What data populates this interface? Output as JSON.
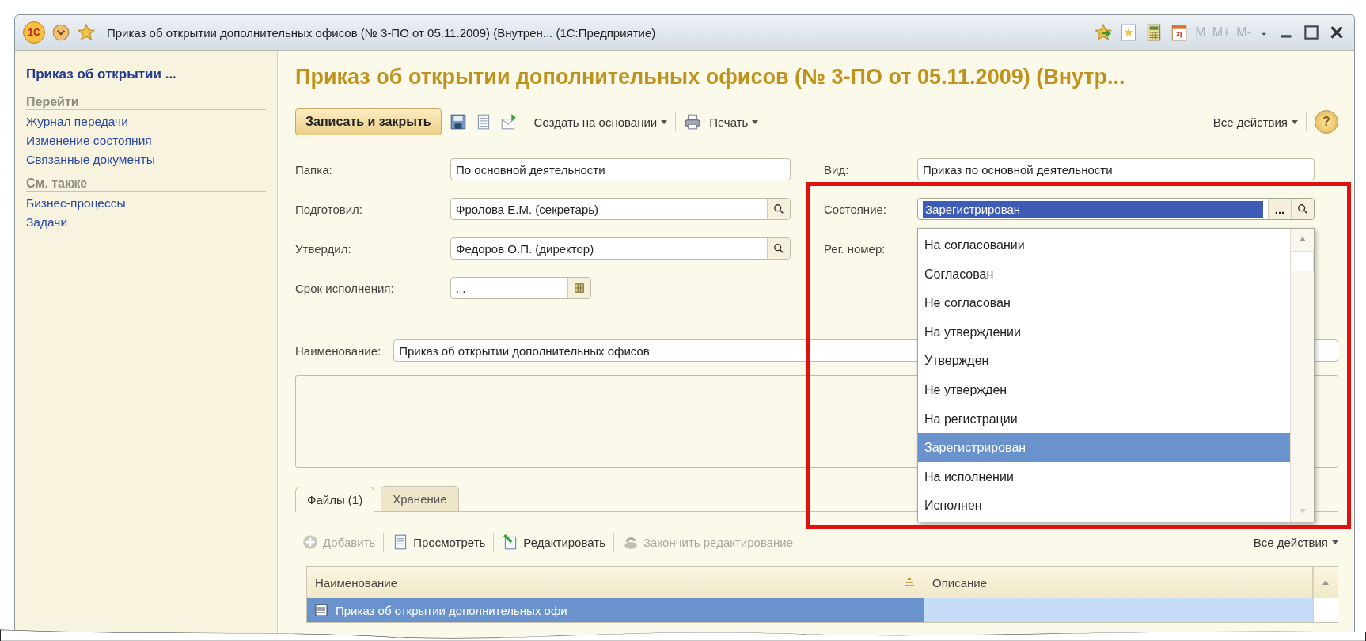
{
  "title_bar": {
    "logo": "1С",
    "title": "Приказ об открытии дополнительных офисов (№ 3-ПО от 05.11.2009) (Внутрен...  (1С:Предприятие)",
    "memory_buttons": [
      "M",
      "M+",
      "M-"
    ]
  },
  "sidebar": {
    "title": "Приказ об открытии ...",
    "sections": [
      {
        "heading": "Перейти",
        "items": [
          "Журнал передачи",
          "Изменение состояния",
          "Связанные документы"
        ]
      },
      {
        "heading": "См. также",
        "items": [
          "Бизнес-процессы",
          "Задачи"
        ]
      }
    ]
  },
  "form": {
    "title": "Приказ об открытии дополнительных офисов (№ 3-ПО от 05.11.2009) (Внутр...",
    "toolbar": {
      "primary": "Записать и закрыть",
      "create_based": "Создать на основании",
      "print": "Печать",
      "all_actions": "Все действия",
      "help": "?"
    },
    "folder": {
      "label": "Папка:",
      "value": "По основной деятельности"
    },
    "kind": {
      "label": "Вид:",
      "value": "Приказ по основной деятельности"
    },
    "prepared_by": {
      "label": "Подготовил:",
      "value": "Фролова Е.М. (секретарь)"
    },
    "state": {
      "label": "Состояние:",
      "value": "Зарегистрирован",
      "more": "...",
      "options": [
        {
          "label": "На согласовании",
          "selected": false
        },
        {
          "label": "Согласован",
          "selected": false
        },
        {
          "label": "Не согласован",
          "selected": false
        },
        {
          "label": "На утверждении",
          "selected": false
        },
        {
          "label": "Утвержден",
          "selected": false
        },
        {
          "label": "Не утвержден",
          "selected": false
        },
        {
          "label": "На регистрации",
          "selected": false
        },
        {
          "label": "Зарегистрирован",
          "selected": true
        },
        {
          "label": "На исполнении",
          "selected": false
        },
        {
          "label": "Исполнен",
          "selected": false
        }
      ]
    },
    "approved_by": {
      "label": "Утвердил:",
      "value": "Федоров О.П. (директор)"
    },
    "reg_number": {
      "label": "Рег. номер:"
    },
    "due_date": {
      "label": "Срок исполнения:",
      "value": " .  ."
    },
    "name": {
      "label": "Наименование:",
      "value": "Приказ об открытии дополнительных офисов"
    },
    "tabs": [
      {
        "label": "Файлы (1)",
        "selected": true
      },
      {
        "label": "Хранение",
        "selected": false
      }
    ],
    "files_toolbar": [
      {
        "kind": "add",
        "label": "Добавить",
        "disabled": true
      },
      {
        "kind": "view",
        "label": "Просмотреть",
        "disabled": false
      },
      {
        "kind": "edit",
        "label": "Редактировать",
        "disabled": false
      },
      {
        "kind": "finish",
        "label": "Закончить редактирование",
        "disabled": true
      }
    ],
    "files_all_actions": "Все действия",
    "table": {
      "columns": [
        "Наименование",
        "Описание"
      ],
      "rows": [
        {
          "name": "Приказ об открытии дополнительных офи",
          "selected": true
        }
      ]
    }
  }
}
